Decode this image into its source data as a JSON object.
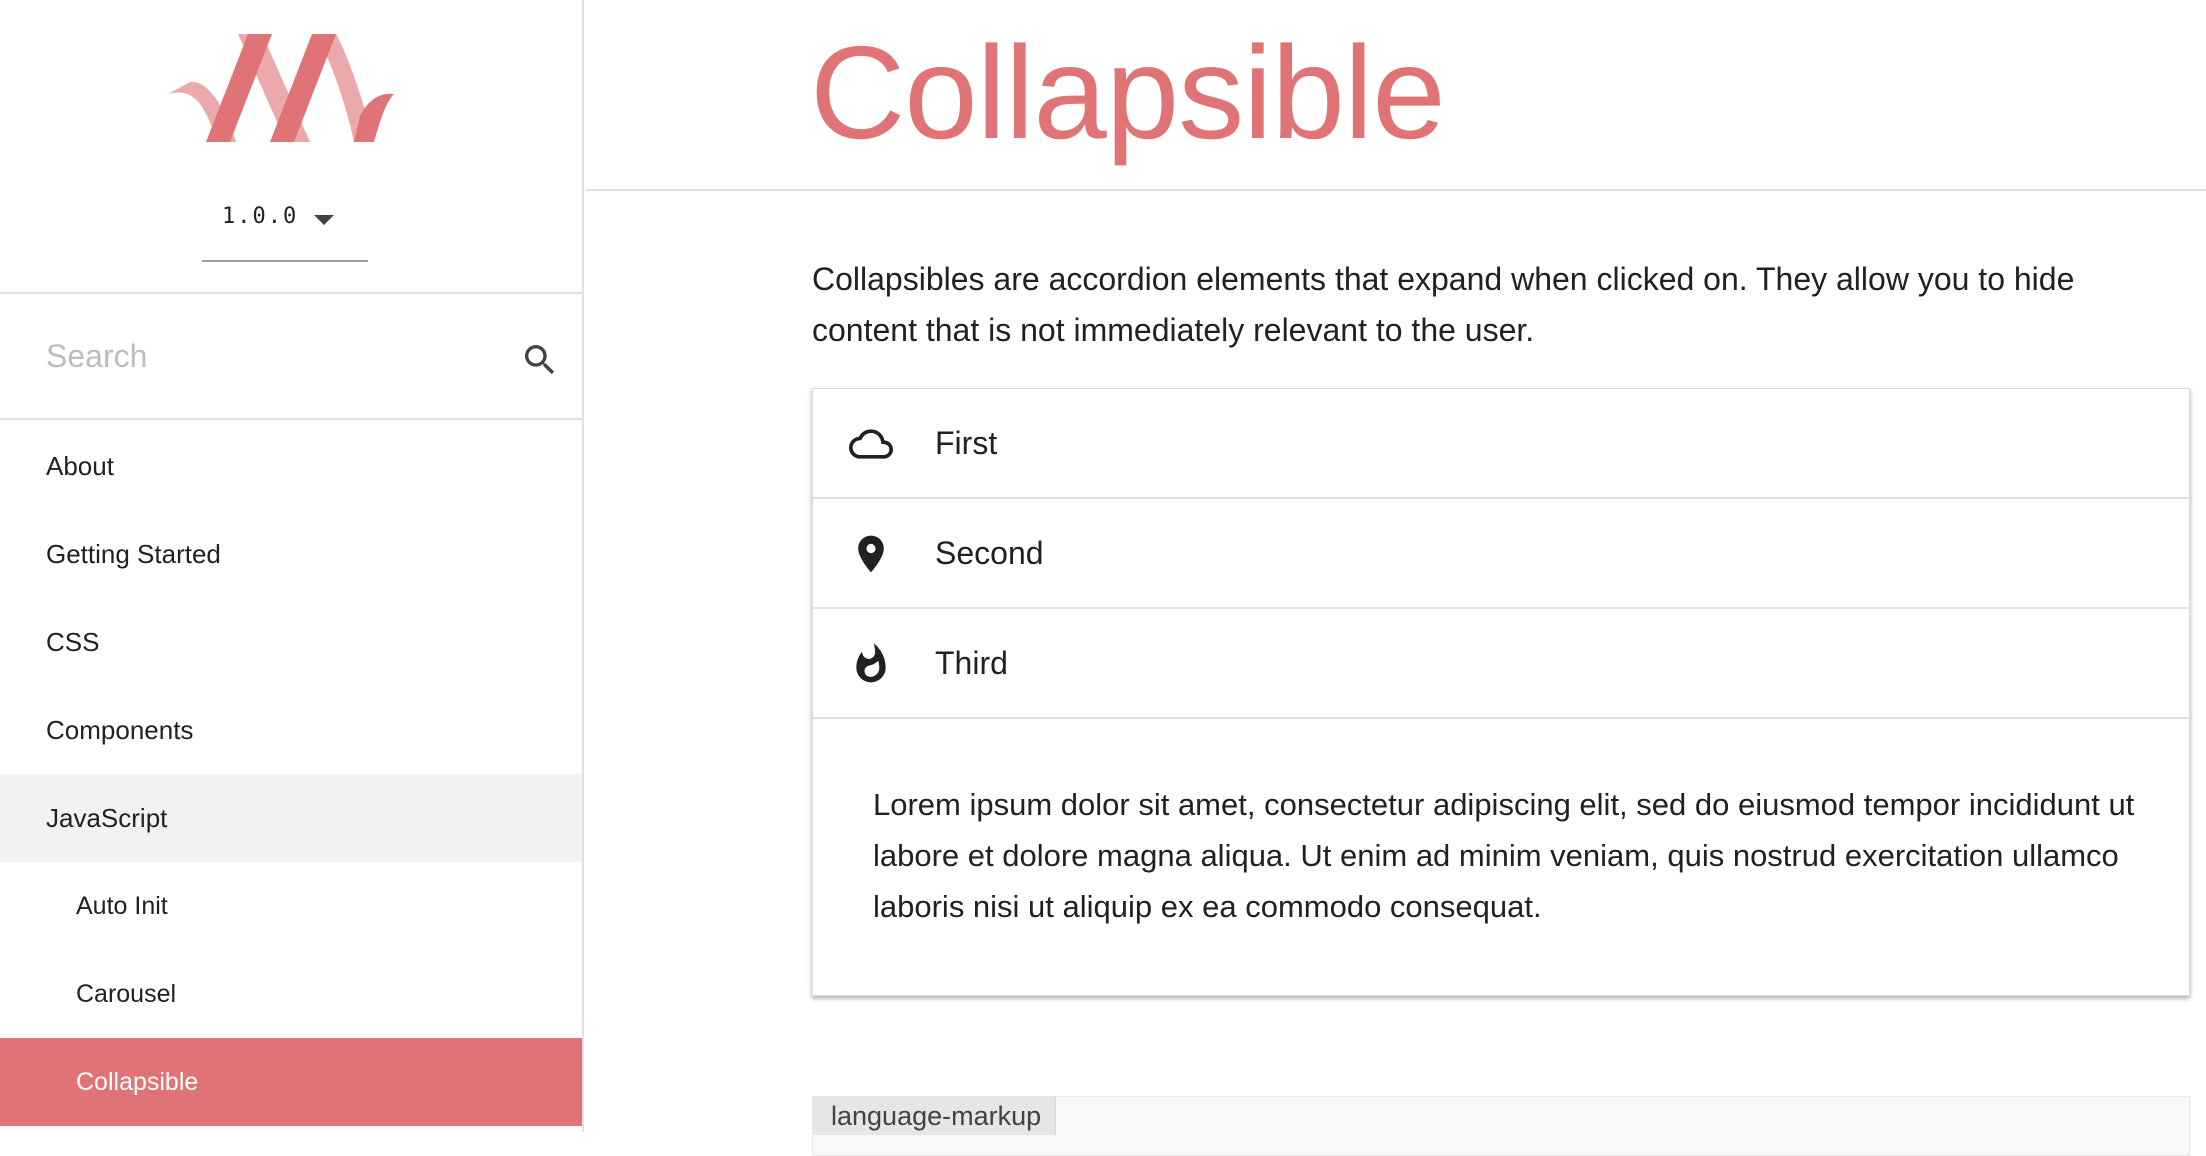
{
  "sidebar": {
    "version": "1.0.0",
    "search": {
      "placeholder": "Search",
      "value": ""
    },
    "items": [
      {
        "label": "About"
      },
      {
        "label": "Getting Started"
      },
      {
        "label": "CSS"
      },
      {
        "label": "Components"
      },
      {
        "label": "JavaScript"
      },
      {
        "label": "Auto Init"
      },
      {
        "label": "Carousel"
      },
      {
        "label": "Collapsible"
      }
    ]
  },
  "main": {
    "title": "Collapsible",
    "intro": "Collapsibles are accordion elements that expand when clicked on. They allow you to hide content that is not immediately relevant to the user.",
    "collapsible": {
      "items": [
        {
          "label": "First",
          "icon": "cloud-icon"
        },
        {
          "label": "Second",
          "icon": "place-icon"
        },
        {
          "label": "Third",
          "icon": "whatshot-icon"
        }
      ],
      "expanded_body": "Lorem ipsum dolor sit amet, consectetur adipiscing elit, sed do eiusmod tempor incididunt ut labore et dolore magna aliqua. Ut enim ad minim veniam, quis nostrud exercitation ullamco laboris nisi ut aliquip ex ea commodo consequat."
    },
    "code_block": {
      "language_label": "language-markup"
    }
  },
  "colors": {
    "accent": "#e07375",
    "accent_light": "#eba9ab",
    "active_bg": "#f2f2f2",
    "border": "#e0e0e0"
  }
}
